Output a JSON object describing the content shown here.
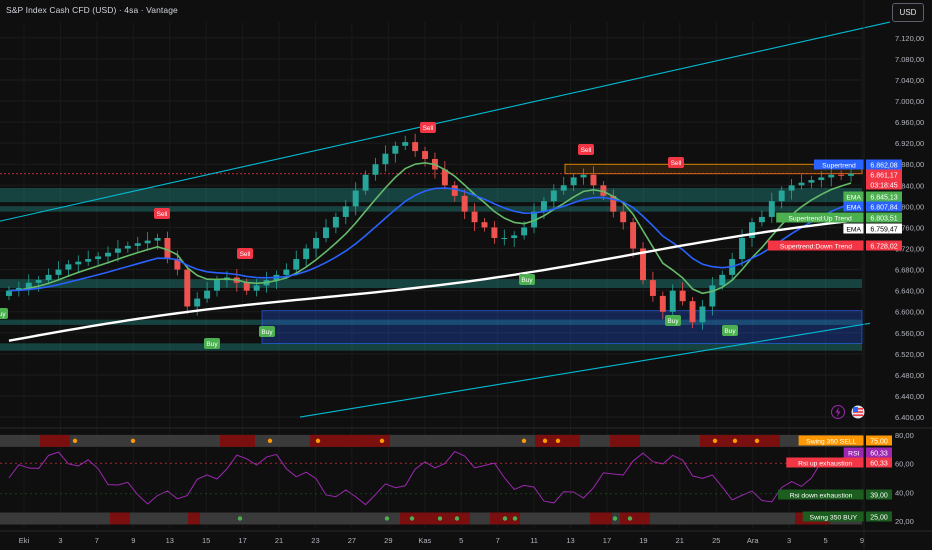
{
  "header": {
    "title": "S&P Index Cash CFD (USD) · 4sa · Vantage",
    "currency_button": "USD"
  },
  "colors": {
    "background": "#0f0f0f",
    "up_candle": "#26a69a",
    "down_candle": "#ef5350",
    "ema_fast": "#2962ff",
    "ema_slow": "#ffffff",
    "channel": "#00bcd4",
    "supertrend_up": "#4caf50",
    "supertrend_down": "#f23645"
  },
  "chart_data": {
    "type": "candlestick",
    "symbol": "S&P Index Cash CFD (USD)",
    "timeframe": "4sa",
    "broker": "Vantage",
    "y_axis": {
      "ticks": [
        "7.120,00",
        "7.080,00",
        "7.040,00",
        "7.000,00",
        "6.960,00",
        "6.920,00",
        "6.880,00",
        "6.840,00",
        "6.800,00",
        "6.760,00",
        "6.720,00",
        "6.680,00",
        "6.640,00",
        "6.600,00",
        "6.560,00",
        "6.520,00",
        "6.480,00",
        "6.440,00",
        "6.400,00"
      ],
      "range": [
        6385,
        7150
      ]
    },
    "x_axis": {
      "ticks": [
        "Eki",
        "3",
        "7",
        "9",
        "13",
        "15",
        "17",
        "21",
        "23",
        "27",
        "29",
        "Kas",
        "5",
        "7",
        "11",
        "13",
        "17",
        "19",
        "21",
        "25",
        "Ara",
        "3",
        "5",
        "9"
      ]
    },
    "price_closes": [
      6640,
      6645,
      6655,
      6660,
      6670,
      6680,
      6690,
      6695,
      6700,
      6705,
      6712,
      6720,
      6725,
      6730,
      6735,
      6740,
      6700,
      6680,
      6610,
      6625,
      6640,
      6660,
      6665,
      6655,
      6640,
      6650,
      6660,
      6670,
      6680,
      6700,
      6720,
      6740,
      6760,
      6780,
      6800,
      6830,
      6860,
      6880,
      6900,
      6915,
      6922,
      6905,
      6890,
      6870,
      6840,
      6820,
      6790,
      6770,
      6760,
      6740,
      6740,
      6745,
      6760,
      6790,
      6810,
      6830,
      6840,
      6855,
      6860,
      6840,
      6820,
      6790,
      6770,
      6720,
      6660,
      6630,
      6600,
      6640,
      6620,
      6580,
      6610,
      6650,
      6670,
      6700,
      6740,
      6770,
      6780,
      6810,
      6830,
      6840,
      6845,
      6850,
      6855,
      6860,
      6858,
      6862
    ],
    "labels": {
      "sell": [
        "Sell",
        "Sell",
        "Sell",
        "Sell",
        "Sell"
      ],
      "buy": [
        "Buy",
        "Buy",
        "Buy",
        "Buy",
        "Buy",
        "Buy"
      ]
    },
    "price_labels": [
      {
        "name": "Supertrend",
        "value": "6.862,08",
        "color": "#2962ff"
      },
      {
        "name": "",
        "value": "6.861,17",
        "color": "#f23645"
      },
      {
        "name": "",
        "value": "03:18:45",
        "color": "#f23645"
      },
      {
        "name": "EMA",
        "value": "6.845,13",
        "color": "#4caf50"
      },
      {
        "name": "EMA",
        "value": "6.807,84",
        "color": "#2962ff"
      },
      {
        "name": "Supertrend:Up Trend",
        "value": "6.803,51",
        "color": "#4caf50"
      },
      {
        "name": "EMA",
        "value": "6.759,47",
        "color": "#ffffff"
      },
      {
        "name": "Supertrend:Down Trend",
        "value": "6.728,02",
        "color": "#f23645"
      }
    ],
    "oscillator": {
      "ticks": [
        "80,00",
        "60,00",
        "40,00",
        "20,00"
      ],
      "labels": [
        {
          "name": "Swing 350 SELL",
          "value": "75,00",
          "color": "#ff9800"
        },
        {
          "name": "RSI",
          "value": "60,33",
          "color": "#9c27b0"
        },
        {
          "name": "Rsi up exhaustion",
          "value": "60,33",
          "color": "#f23645"
        },
        {
          "name": "Rsi down exhaustion",
          "value": "39,00",
          "color": "#1b5e20"
        },
        {
          "name": "Swing 350 BUY",
          "value": "25,00",
          "color": "#1b5e20"
        }
      ]
    }
  }
}
